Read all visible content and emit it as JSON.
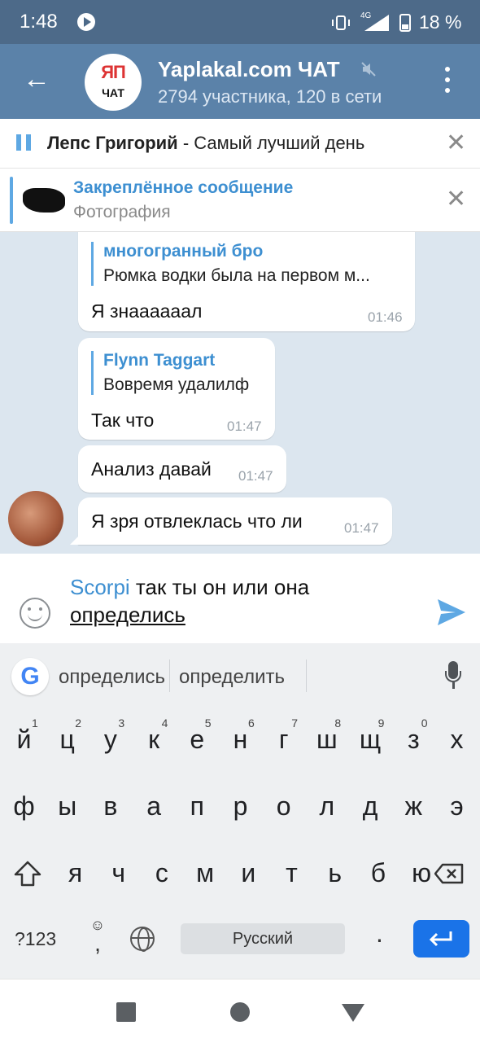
{
  "status_bar": {
    "time": "1:48",
    "signal_label": "4G",
    "battery": "18 %"
  },
  "header": {
    "avatar_text_top": "ЯП",
    "avatar_text_bottom": "ЧАТ",
    "title": "Yaplakal.com ЧАТ",
    "subtitle": "2794 участника, 120 в сети"
  },
  "player": {
    "artist": "Лепс Григорий",
    "separator": " - ",
    "title": "Самый лучший день"
  },
  "pinned": {
    "title": "Закреплённое сообщение",
    "subtitle": "Фотография"
  },
  "messages": [
    {
      "reply_name": "многогранный бро",
      "reply_text": "Рюмка водки была на первом м...",
      "text": "Я знаааааал",
      "time": "01:46"
    },
    {
      "reply_name": "Flynn Taggart",
      "reply_text": "Вовремя удалилф",
      "text": "Так что",
      "time": "01:47"
    },
    {
      "text": "Анализ давай",
      "time": "01:47"
    },
    {
      "text": "Я зря отвлеклась что ли",
      "time": "01:47"
    }
  ],
  "composer": {
    "mention": "Scorpi",
    "line1_rest": " так ты он или она",
    "line2": "определись"
  },
  "keyboard": {
    "suggestions": [
      "определись",
      "определить"
    ],
    "row1": [
      {
        "ch": "й",
        "num": "1"
      },
      {
        "ch": "ц",
        "num": "2"
      },
      {
        "ch": "у",
        "num": "3"
      },
      {
        "ch": "к",
        "num": "4"
      },
      {
        "ch": "е",
        "num": "5"
      },
      {
        "ch": "н",
        "num": "6"
      },
      {
        "ch": "г",
        "num": "7"
      },
      {
        "ch": "ш",
        "num": "8"
      },
      {
        "ch": "щ",
        "num": "9"
      },
      {
        "ch": "з",
        "num": "0"
      },
      {
        "ch": "х",
        "num": ""
      }
    ],
    "row2": [
      "ф",
      "ы",
      "в",
      "а",
      "п",
      "р",
      "о",
      "л",
      "д",
      "ж",
      "э"
    ],
    "row3": [
      "я",
      "ч",
      "с",
      "м",
      "и",
      "т",
      "ь",
      "б",
      "ю"
    ],
    "symbols_key": "?123",
    "comma": ",",
    "space_label": "Русский",
    "period": "."
  },
  "colors": {
    "header": "#5b82a9",
    "status_bar": "#4d6a89",
    "accent": "#3d8fd1",
    "enter_key": "#1a73e8"
  }
}
